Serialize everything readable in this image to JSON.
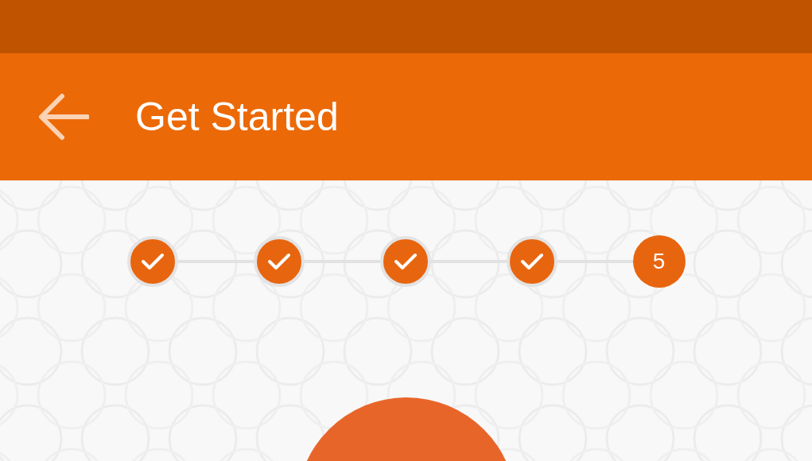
{
  "app_bar": {
    "title": "Get Started"
  },
  "steps": [
    {
      "completed": true
    },
    {
      "completed": true
    },
    {
      "completed": true
    },
    {
      "completed": true
    },
    {
      "completed": false,
      "label": "5"
    }
  ]
}
